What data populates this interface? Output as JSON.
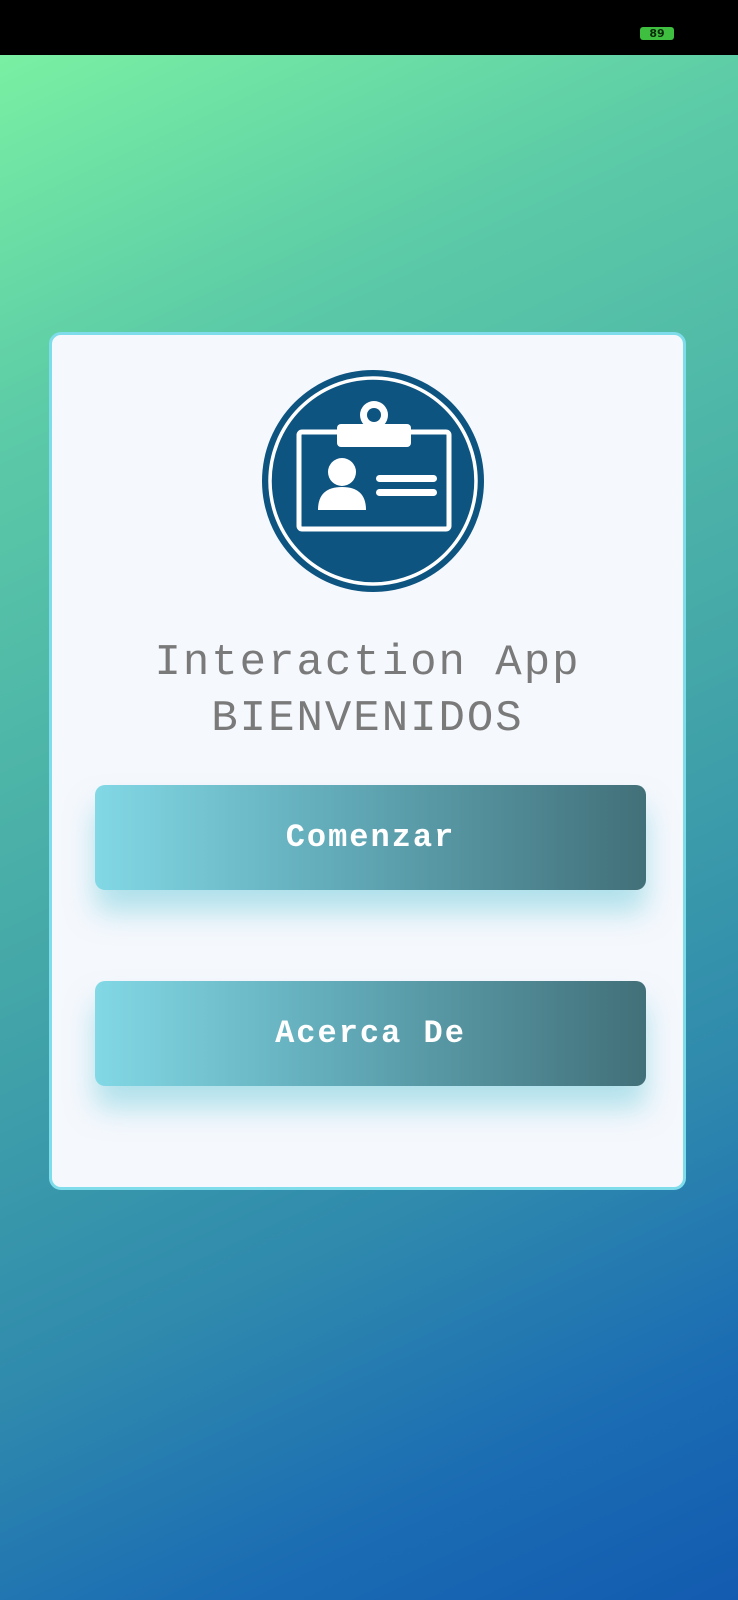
{
  "status_bar": {
    "battery_level": "89"
  },
  "app": {
    "title_line1": "Interaction App",
    "title_line2": "BIENVENIDOS",
    "logo_icon": "id-badge-icon"
  },
  "buttons": {
    "start_label": "Comenzar",
    "about_label": "Acerca De"
  },
  "colors": {
    "logo_blue": "#0e5480",
    "title_gray": "#7a7a7a",
    "card_border": "#7fdcea",
    "button_gradient_start": "#82d8e5",
    "button_gradient_end": "#427079",
    "background_top": "#7df5a2",
    "background_bottom": "#135bb0"
  }
}
